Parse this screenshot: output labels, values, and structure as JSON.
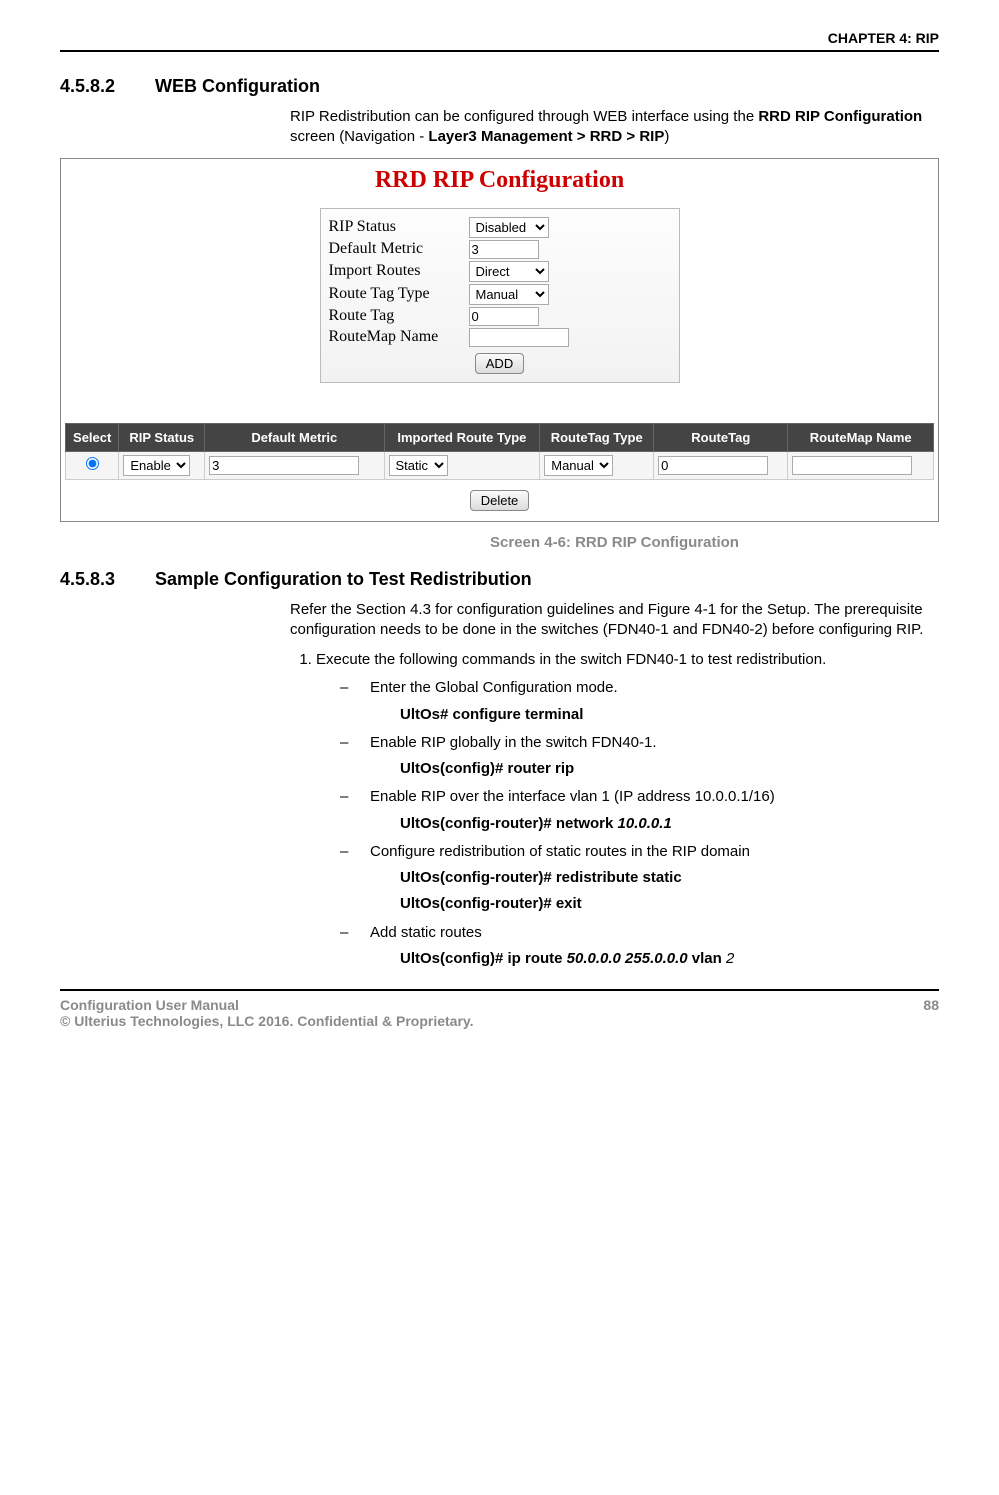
{
  "header": {
    "chapter": "CHAPTER 4: RIP"
  },
  "sec1": {
    "num": "4.5.8.2",
    "title": "WEB Configuration",
    "intro_pre": "RIP Redistribution can be configured through WEB interface using the ",
    "intro_bold1": "RRD RIP Configuration",
    "intro_mid": " screen (Navigation - ",
    "intro_bold2": "Layer3 Management > RRD > RIP",
    "intro_post": ")"
  },
  "rrd": {
    "title": "RRD RIP Configuration",
    "labels": {
      "rip_status": "RIP Status",
      "default_metric": "Default Metric",
      "import_routes": "Import Routes",
      "route_tag_type": "Route Tag Type",
      "route_tag": "Route Tag",
      "routemap_name": "RouteMap Name"
    },
    "values": {
      "rip_status": "Disabled",
      "default_metric": "3",
      "import_routes": "Direct",
      "route_tag_type": "Manual",
      "route_tag": "0",
      "routemap_name": ""
    },
    "add_btn": "ADD",
    "table": {
      "headers": {
        "select": "Select",
        "rip_status": "RIP Status",
        "default_metric": "Default Metric",
        "imported_route_type": "Imported Route Type",
        "routetag_type": "RouteTag Type",
        "routetag": "RouteTag",
        "routemap_name": "RouteMap Name"
      },
      "row": {
        "rip_status": "Enable",
        "default_metric": "3",
        "imported_route_type": "Static",
        "routetag_type": "Manual",
        "routetag": "0",
        "routemap_name": ""
      }
    },
    "delete_btn": "Delete"
  },
  "caption": "Screen 4-6: RRD RIP Configuration",
  "sec2": {
    "num": "4.5.8.3",
    "title": "Sample Configuration to Test Redistribution",
    "intro": "Refer the Section 4.3 for configuration guidelines and Figure 4-1 for the Setup. The prerequisite configuration needs to be done in the switches (FDN40-1 and FDN40-2) before configuring RIP.",
    "item1": "Execute the following commands in the switch FDN40-1 to test redistribution.",
    "steps": {
      "a": "Enter the Global Configuration mode.",
      "a_cmd": "UltOs# configure terminal",
      "b": "Enable RIP globally in the switch FDN40-1.",
      "b_cmd": "UltOs(config)# router rip",
      "c": "Enable RIP over the interface vlan 1 (IP address 10.0.0.1/16)",
      "c_cmd_pre": "UltOs(config-router)# network ",
      "c_cmd_arg": "10.0.0.1",
      "d": "Configure redistribution of static routes in the RIP domain",
      "d_cmd1": "UltOs(config-router)# redistribute static",
      "d_cmd2": "UltOs(config-router)# exit",
      "e": "Add static routes",
      "e_cmd_pre": "UltOs(config)# ip route ",
      "e_cmd_arg": "50.0.0.0 255.0.0.0",
      "e_cmd_mid": " vlan ",
      "e_cmd_arg2": "2"
    }
  },
  "footer": {
    "left1": "Configuration User Manual",
    "left2": "© Ulterius Technologies, LLC 2016. Confidential & Proprietary.",
    "page": "88"
  }
}
